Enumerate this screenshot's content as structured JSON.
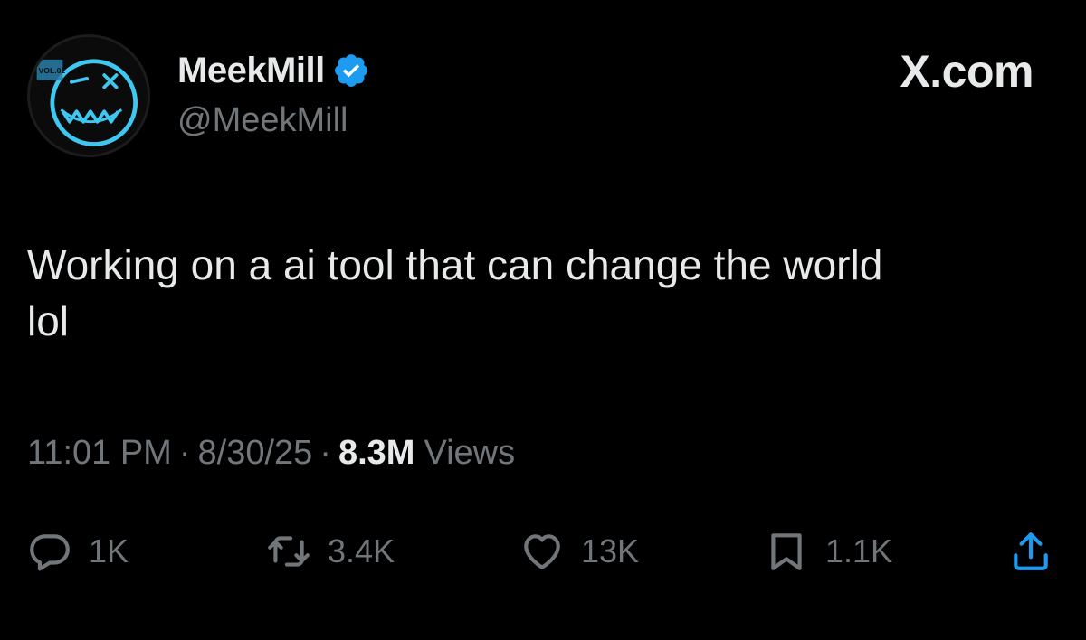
{
  "tweet": {
    "display_name": "MeekMill",
    "handle": "@MeekMill",
    "brand": "X.com",
    "text_line1": "Working on a ai tool that can change the world",
    "text_line2": "lol",
    "time": "11:01 PM",
    "date": "8/30/25",
    "separator": "·",
    "views_count": "8.3M",
    "views_label": "Views",
    "avatar_badge_text": "VOL.01",
    "verified_color": "#1d9bf0"
  },
  "actions": {
    "reply": {
      "icon": "reply-icon",
      "count": "1K"
    },
    "retweet": {
      "icon": "retweet-icon",
      "count": "3.4K"
    },
    "like": {
      "icon": "heart-icon",
      "count": "13K"
    },
    "bookmark": {
      "icon": "bookmark-icon",
      "count": "1.1K"
    },
    "share": {
      "icon": "share-icon"
    }
  },
  "colors": {
    "background": "#000000",
    "primary_text": "#e7e9ea",
    "secondary_text": "#71767b",
    "accent": "#1d9bf0",
    "avatar_glow": "#3ec7f0"
  }
}
